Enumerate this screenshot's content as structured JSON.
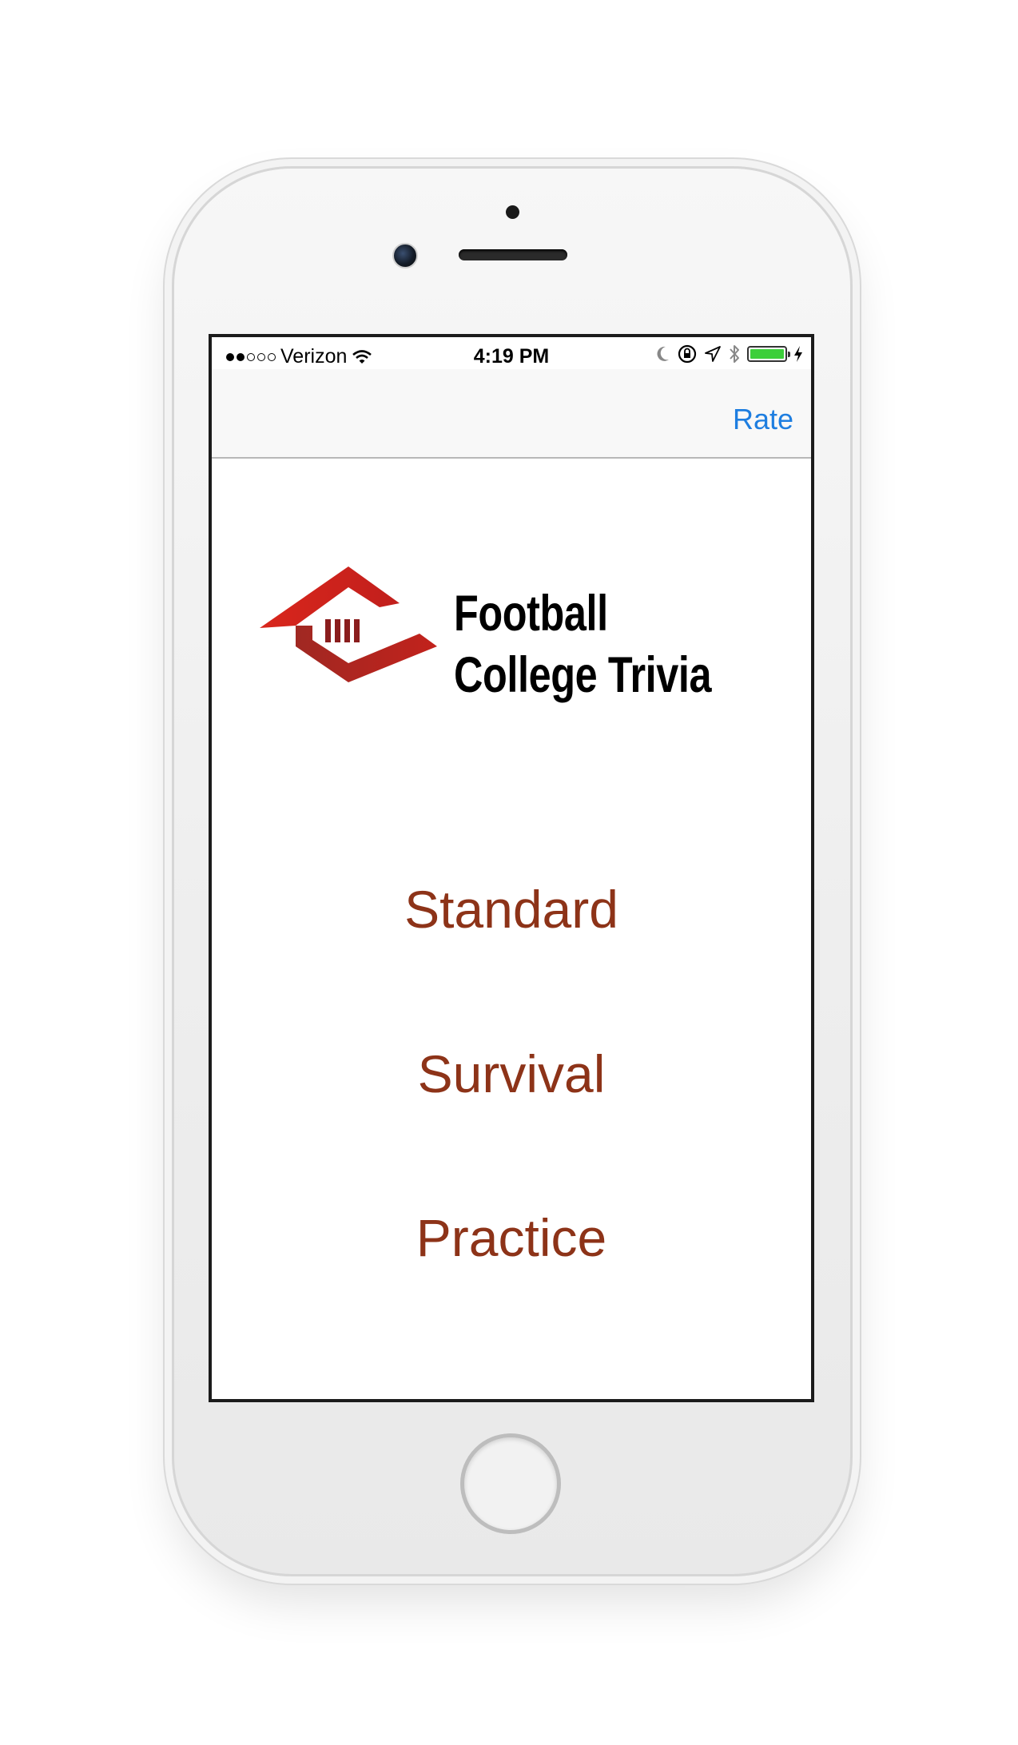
{
  "status_bar": {
    "carrier": "Verizon",
    "time": "4:19 PM",
    "signal_strength": 2,
    "signal_max": 5,
    "battery_level": 1.0,
    "icons": [
      "wifi-icon",
      "moon-icon",
      "rotation-lock-icon",
      "location-arrow-icon",
      "bluetooth-icon",
      "battery-icon",
      "charging-bolt-icon"
    ]
  },
  "nav": {
    "rate_label": "Rate"
  },
  "brand": {
    "line1": "Football",
    "line2": "College Trivia",
    "colors": {
      "logo_red": "#d9261c",
      "logo_dark": "#8a1d1d",
      "text": "#000000"
    }
  },
  "menu": {
    "options": [
      {
        "label": "Standard"
      },
      {
        "label": "Survival"
      },
      {
        "label": "Practice"
      }
    ],
    "color": "#8d3318"
  },
  "theme": {
    "accent_blue": "#1e7ee0"
  }
}
